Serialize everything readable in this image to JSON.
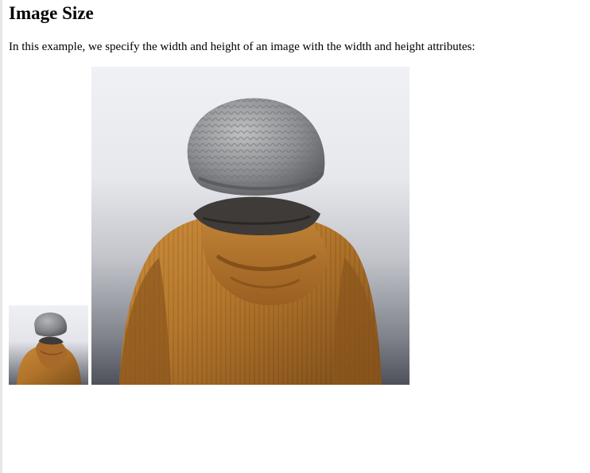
{
  "page": {
    "heading": "Image Size",
    "description": "In this example, we specify the width and height of an image with the width and height attributes:"
  },
  "images": [
    {
      "name": "photo-small",
      "subject": "person-in-beanie-and-jacket"
    },
    {
      "name": "photo-large",
      "subject": "person-in-beanie-and-jacket"
    }
  ],
  "colors": {
    "background": "#ffffff",
    "text": "#000000",
    "jacket": "#b8782c",
    "beanie": "#8a8a8a",
    "sky": "#eef0f3"
  }
}
